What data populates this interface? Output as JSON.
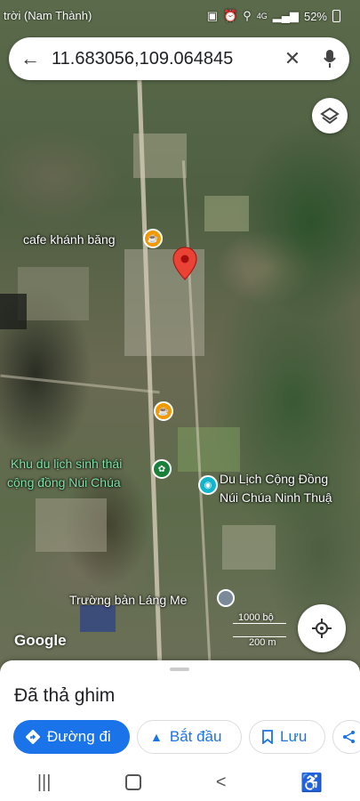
{
  "status_bar": {
    "left_text": "trời (Nam Thành)",
    "battery": "52%",
    "network": "4G"
  },
  "search": {
    "query": "11.683056,109.064845"
  },
  "map_labels": {
    "cafe": "cafe khánh băng",
    "eco_line1": "Khu du lịch sinh thái",
    "eco_line2": "cộng đồng Núi Chúa",
    "community_line1": "Du Lịch Cộng Đồng",
    "community_line2": "Núi Chúa Ninh Thuậ",
    "school": "Trường bản Láng Me"
  },
  "map": {
    "attribution": "Google",
    "scale_top": "1000 bộ",
    "scale_bottom": "200 m"
  },
  "sheet": {
    "title": "Đã thả ghim",
    "directions": "Đường đi",
    "start": "Bắt đầu",
    "save": "Lưu"
  },
  "colors": {
    "accent": "#1a73e8",
    "pin": "#ea4335",
    "cafe_pin": "#f29900",
    "park_pin": "#188038"
  }
}
